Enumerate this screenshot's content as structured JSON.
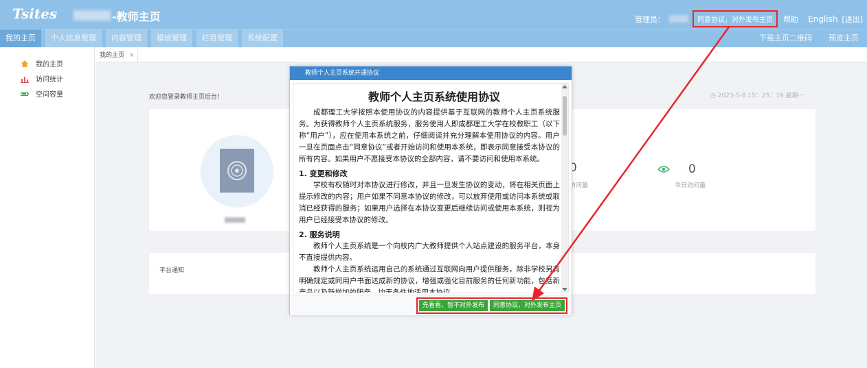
{
  "header": {
    "logo": "Tsites",
    "site_title": "-教师主页",
    "admin_label": "管理员：",
    "agree_top": "同意协议，对外发布主页",
    "help": "帮助",
    "english": "English",
    "logout": "[退出]"
  },
  "nav": {
    "items": [
      {
        "label": "我的主页",
        "active": true
      },
      {
        "label": "个人信息管理"
      },
      {
        "label": "内容管理"
      },
      {
        "label": "模板管理"
      },
      {
        "label": "栏目管理"
      },
      {
        "label": "系统配置"
      }
    ],
    "right": {
      "qrcode": "下载主页二维码",
      "preview": "预览主页"
    }
  },
  "sidebar": {
    "items": [
      {
        "label": "我的主页",
        "icon": "home-icon"
      },
      {
        "label": "访问统计",
        "icon": "bar-chart-icon"
      },
      {
        "label": "空间容量",
        "icon": "battery-icon"
      }
    ]
  },
  "tabs": [
    {
      "label": "我的主页",
      "close": "×"
    }
  ],
  "main": {
    "welcome": "欢迎您登录教师主页后台！",
    "datetime": "2023-5-8 15：25：19 星期一",
    "stats": {
      "total_value": "0",
      "total_label": "访问量",
      "today_value": "0",
      "today_label": "今日访问量"
    },
    "notice_title": "平台通知"
  },
  "dialog": {
    "header": "教师个人主页系统开通协议",
    "title": "教师个人主页系统使用协议",
    "paragraphs": {
      "p1": "成都理工大学按照本使用协议的内容提供基于互联网的教师个人主页系统服务。为获得教师个人主页系统服务，服务使用人即成都理工大学在校教职工（以下称“用户”），应在使用本系统之前，仔细阅读并充分理解本使用协议的内容。用户一旦在页面点击“同意协议”或者开始访问和使用本系统，即表示同意接受本协议的所有内容。如果用户不愿接受本协议的全部内容，请不要访问和使用本系统。",
      "s1": "1. 变更和修改",
      "p2": "学校有权随时对本协议进行修改，并且一旦发生协议的变动，将在相关页面上提示修改的内容；用户如果不同意本协议的修改，可以放弃使用或访问本系统或取消已经获得的服务；如果用户选择在本协议变更后继续访问或使用本系统，则视为用户已经接受本协议的修改。",
      "s2": "2. 服务说明",
      "p3": "教师个人主页系统是一个向校内广大教师提供个人站点建设的服务平台，本身不直接提供内容。",
      "p4": "教师个人主页系统运用自己的系统通过互联网向用户提供服务，除非学校另有明确规定或同用户书面达成新的协议，增强或强化目前服务的任何新功能，包括新产品以及新增加的服务，均无条件地适用本协议。"
    },
    "buttons": {
      "later": "先看看，暂不对外发布",
      "agree": "同意协议，对外发布主页"
    }
  },
  "colors": {
    "header_bg": "#8fc1e8",
    "nav_active": "#6ba8db",
    "dialog_head": "#3a87d0",
    "button_green": "#3aa63a",
    "highlight_red": "#e8262a"
  }
}
